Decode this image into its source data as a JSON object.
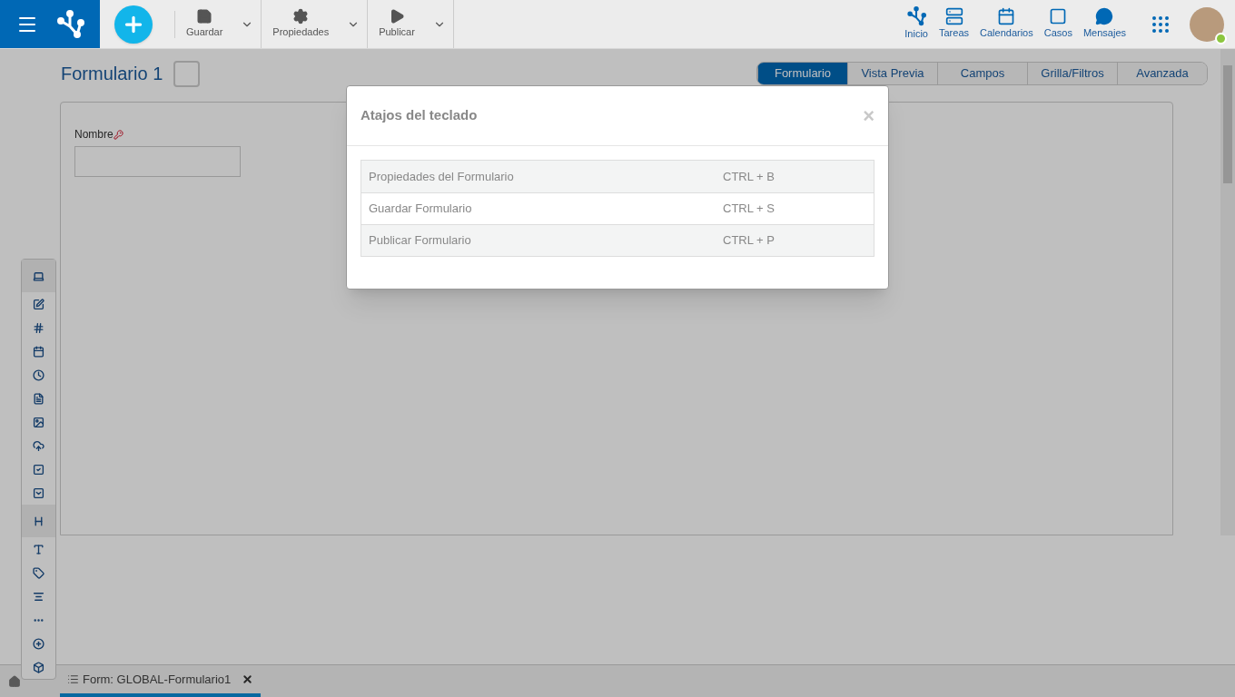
{
  "toolbar": {
    "actions": [
      {
        "label": "Guardar"
      },
      {
        "label": "Propiedades"
      },
      {
        "label": "Publicar"
      }
    ]
  },
  "nav": [
    {
      "label": "Inicio"
    },
    {
      "label": "Tareas"
    },
    {
      "label": "Calendarios"
    },
    {
      "label": "Casos"
    },
    {
      "label": "Mensajes"
    }
  ],
  "user": {
    "online": true
  },
  "form": {
    "title": "Formulario 1",
    "tabs": [
      {
        "label": "Formulario",
        "selected": true
      },
      {
        "label": "Vista Previa",
        "selected": false
      },
      {
        "label": "Campos",
        "selected": false
      },
      {
        "label": "Grilla/Filtros",
        "selected": false
      },
      {
        "label": "Avanzada",
        "selected": false
      }
    ],
    "fields": [
      {
        "label": "Nombre",
        "key": true
      }
    ]
  },
  "bottom_tabs": [
    {
      "label": "Form: GLOBAL-Formulario1",
      "selected": true
    }
  ],
  "dialog": {
    "title": "Atajos del teclado",
    "close": "×",
    "shortcuts": [
      {
        "action": "Propiedades del Formulario",
        "keys": "CTRL + B"
      },
      {
        "action": "Guardar Formulario",
        "keys": "CTRL + S"
      },
      {
        "action": "Publicar Formulario",
        "keys": "CTRL + P"
      }
    ]
  }
}
